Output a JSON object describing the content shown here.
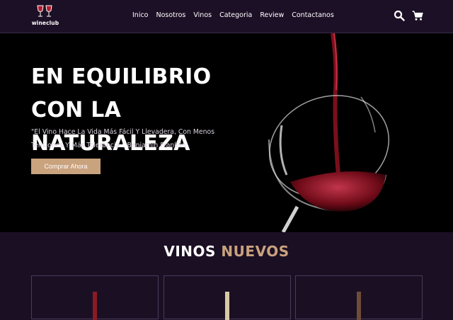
{
  "header": {
    "logo_text": "wineclub",
    "nav": [
      "Inico",
      "Nosotros",
      "Vinos",
      "Categoria",
      "Review",
      "Contactanos"
    ]
  },
  "icons": {
    "search": "search-icon",
    "cart": "cart-icon"
  },
  "hero": {
    "title": "EN EQUILIBRIO CON LA NATURALEZA",
    "quote": "\"El Vino Hace La Vida Más Fácil Y Llevadera, Con Menos Tensiones Y Más Tolerancia.\" Benjamin Franklin.",
    "button": "Comprar Ahora"
  },
  "section": {
    "title_part1": "VINOS",
    "title_part2": "NUEVOS"
  },
  "colors": {
    "accent": "#c9a27e",
    "background": "#1b0f24",
    "hero_bg": "#000000"
  }
}
